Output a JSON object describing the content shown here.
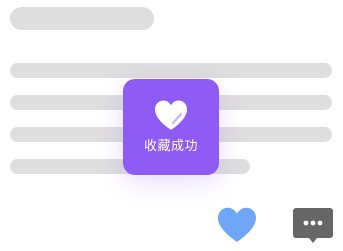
{
  "toast": {
    "label": "收藏成功",
    "icon": "heart-check-icon",
    "background": "#8e5cf5"
  },
  "actions": {
    "like_icon": "heart-icon",
    "like_color": "#6fa6f7",
    "comment_icon": "comment-bubble-icon",
    "comment_color": "#666666"
  }
}
